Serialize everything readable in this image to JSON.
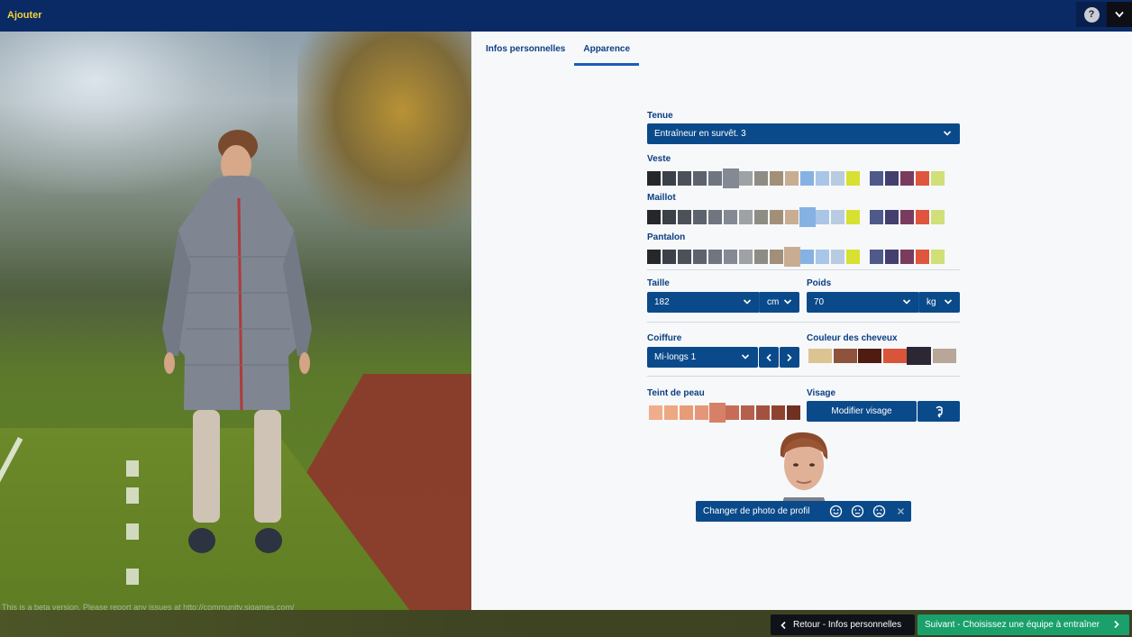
{
  "app": {
    "title": "Ajouter",
    "help_glyph": "?"
  },
  "tabs": [
    {
      "label": "Infos personnelles",
      "active": false
    },
    {
      "label": "Apparence",
      "active": true
    }
  ],
  "beta_notice": "This is a beta version. Please report any issues at http://community.sigames.com/",
  "appearance": {
    "outfit": {
      "label": "Tenue",
      "value": "Entraîneur en survêt. 3"
    },
    "jacket": {
      "label": "Veste",
      "selected_index": 5
    },
    "shirt": {
      "label": "Maillot",
      "selected_index": 10
    },
    "trousers": {
      "label": "Pantalon",
      "selected_index": 9
    },
    "height": {
      "label": "Taille",
      "value": "182",
      "unit": "cm"
    },
    "weight": {
      "label": "Poids",
      "value": "70",
      "unit": "kg"
    },
    "hairstyle": {
      "label": "Coiffure",
      "value": "Mi-longs 1"
    },
    "hair_color": {
      "label": "Couleur des cheveux",
      "selected_index": 4
    },
    "skin_tone": {
      "label": "Teint de peau",
      "selected_index": 4
    },
    "face": {
      "label": "Visage",
      "edit_button": "Modifier visage",
      "randomize_icon": "randomize-icon"
    },
    "photo": {
      "change_label": "Changer de photo de profil",
      "icons": [
        "happy-face-icon",
        "neutral-face-icon",
        "sad-face-icon",
        "close-icon"
      ]
    }
  },
  "palettes": {
    "clothing": [
      "#25272b",
      "#3c4048",
      "#4b5059",
      "#5d636c",
      "#6f7680",
      "#838a93",
      "#9ea2a5",
      "#8f8c86",
      "#a28f78",
      "#c8ad93",
      "#86b2e3",
      "#a9c6e7",
      "#b9cbe1",
      "#d7e132",
      "#4d5a8a",
      "#433f6e",
      "#793c5f",
      "#e0553d",
      "#d1df78"
    ],
    "hair": [
      "#dcc491",
      "#8f533d",
      "#4e1c10",
      "#d9553a",
      "#2c2733",
      "#b9a698"
    ],
    "skin": [
      "#f0ad8b",
      "#eea783",
      "#e89b77",
      "#e59678",
      "#d68068",
      "#c76d56",
      "#b55f4c",
      "#a4523f",
      "#8e4331",
      "#6f3122"
    ]
  },
  "footer": {
    "back_label": "Retour - Infos personnelles",
    "next_label": "Suivant - Choisissez une équipe à entraîner"
  }
}
